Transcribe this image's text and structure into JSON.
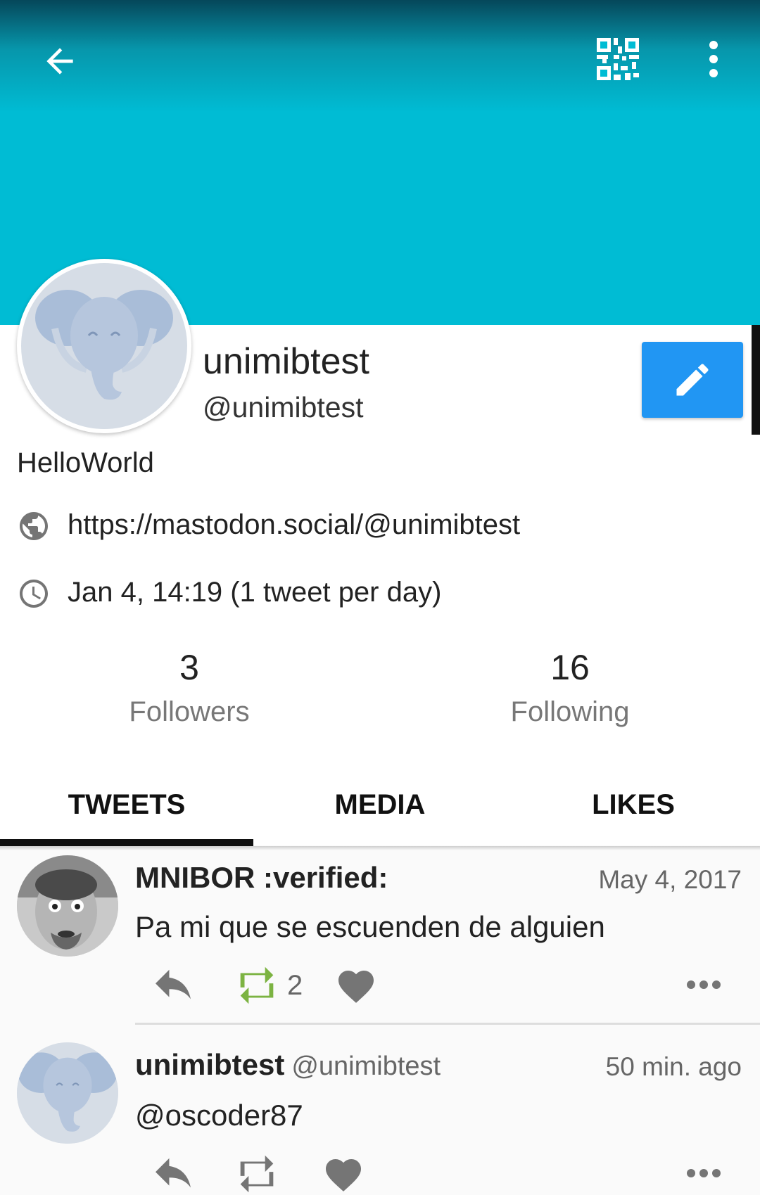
{
  "colors": {
    "header": "#00bcd4",
    "edit_button": "#2196f3",
    "retweet_active": "#7cb342"
  },
  "toolbar": {
    "back_icon": "arrow-back-icon",
    "qr_icon": "qr-code-icon",
    "more_icon": "more-vert-icon"
  },
  "profile": {
    "display_name": "unimibtest",
    "handle": "@unimibtest",
    "bio": "HelloWorld",
    "url": "https://mastodon.social/@unimibtest",
    "joined": "Jan 4, 14:19 (1 tweet per day)",
    "avatar_icon": "elephant-avatar-icon",
    "edit_icon": "pencil-icon"
  },
  "stats": {
    "followers": {
      "count": "3",
      "label": "Followers"
    },
    "following": {
      "count": "16",
      "label": "Following"
    }
  },
  "tabs": [
    {
      "label": "TWEETS",
      "active": true
    },
    {
      "label": "MEDIA",
      "active": false
    },
    {
      "label": "LIKES",
      "active": false
    }
  ],
  "tweets": [
    {
      "author": "MNIBOR :verified:",
      "handle": "",
      "time": "May 4, 2017",
      "text": "Pa mi que se escuenden de alguien",
      "retweets": "2",
      "retweeted": true,
      "avatar_icon": "user-photo-avatar"
    },
    {
      "author": "unimibtest",
      "handle": "@unimibtest",
      "time": "50 min. ago",
      "text": "@oscoder87",
      "retweets": "",
      "retweeted": false,
      "avatar_icon": "elephant-avatar-icon"
    }
  ]
}
